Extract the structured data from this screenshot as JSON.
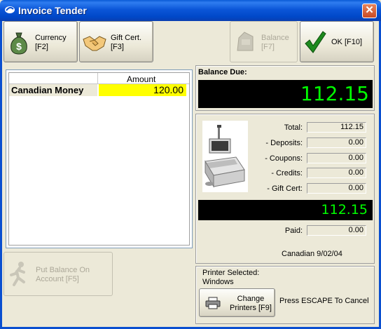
{
  "window": {
    "title": "Invoice Tender",
    "close_glyph": "✕"
  },
  "toolbar": {
    "currency": {
      "label": "Currency\n[F2]",
      "icon": "money-bag-icon"
    },
    "gift_cert": {
      "label": "Gift Cert.\n[F3]",
      "icon": "handshake-icon"
    },
    "balance": {
      "label": "Balance\n[F7]",
      "icon": "balance-icon",
      "enabled": false
    },
    "ok": {
      "label": "OK [F10]",
      "icon": "checkmark-icon"
    }
  },
  "tender_grid": {
    "column_header": "Amount",
    "rows": [
      {
        "name": "Canadian Money",
        "amount": "120.00"
      }
    ]
  },
  "put_balance": {
    "label": "Put Balance On\nAccount [F5]",
    "icon": "running-figure-icon",
    "enabled": false
  },
  "balance_due": {
    "label": "Balance Due:",
    "value": "112.15"
  },
  "summary": {
    "total_label": "Total:",
    "total": "112.15",
    "deposits_label": "- Deposits:",
    "deposits": "0.00",
    "coupons_label": "- Coupons:",
    "coupons": "0.00",
    "credits_label": "- Credits:",
    "credits": "0.00",
    "giftcert_label": "- Gift Cert:",
    "giftcert": "0.00",
    "net_total": "112.15",
    "paid_label": "Paid:",
    "paid": "0.00",
    "currency_date": "Canadian 9/02/04"
  },
  "printer": {
    "selected_label": "Printer Selected:",
    "selected_value": "Windows",
    "change_label": "Change\nPrinters [F9]",
    "escape_hint": "Press ESCAPE To Cancel",
    "icon": "printer-icon"
  },
  "colors": {
    "lcd_text": "#00ff00",
    "highlight": "#ffff00",
    "title_bar": "#0b56d8"
  }
}
